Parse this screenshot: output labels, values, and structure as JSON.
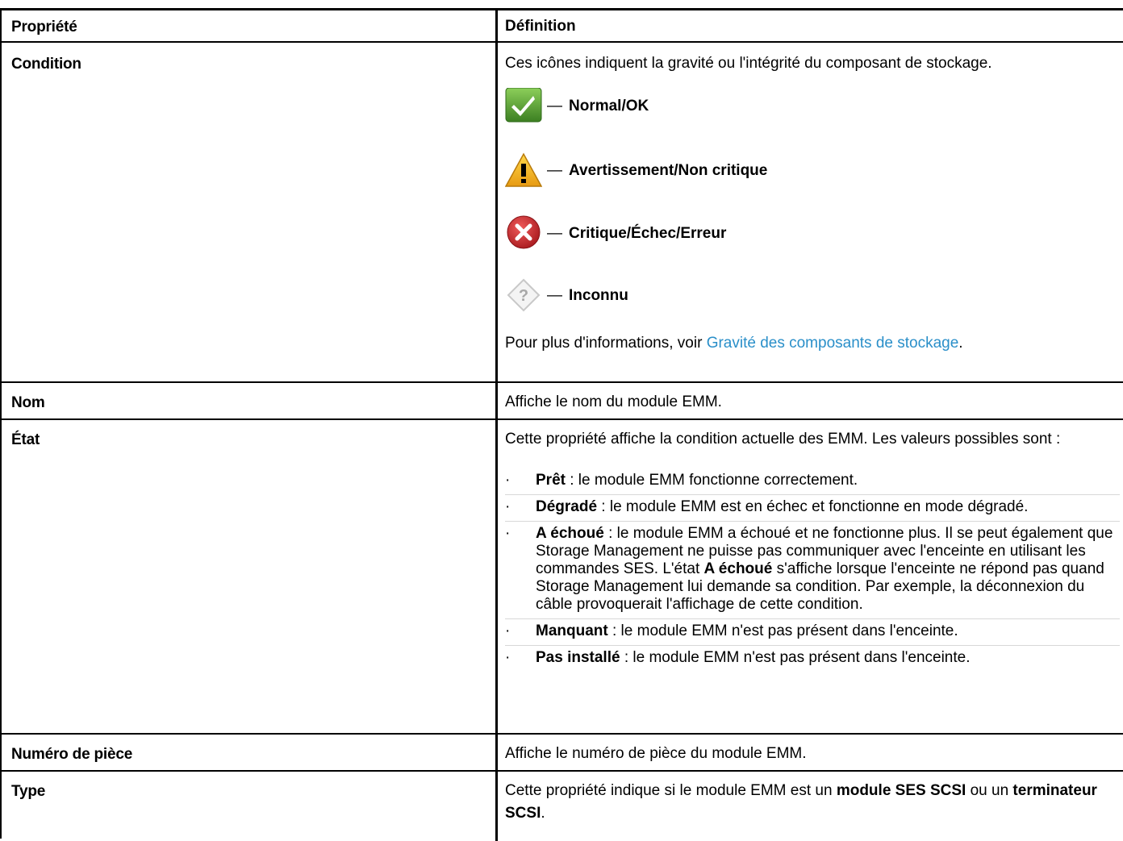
{
  "header": {
    "col1": "Propriété",
    "col2": "Définition"
  },
  "rows": {
    "condition": {
      "label": "Condition",
      "intro": "Ces icônes indiquent la gravité ou l'intégrité du composant de stockage.",
      "statuses": [
        {
          "icon": "ok-check-icon",
          "dash": "—",
          "label": "Normal/OK"
        },
        {
          "icon": "warning-triangle-icon",
          "dash": "—",
          "label": "Avertissement/Non critique"
        },
        {
          "icon": "critical-x-icon",
          "dash": "—",
          "label": "Critique/Échec/Erreur"
        },
        {
          "icon": "unknown-question-icon",
          "dash": "—",
          "label": "Inconnu"
        }
      ],
      "more_prefix": "Pour plus d'informations, voir ",
      "more_link": "Gravité des composants de stockage",
      "more_suffix": "."
    },
    "nom": {
      "label": "Nom",
      "text": "Affiche le nom du module EMM."
    },
    "etat": {
      "label": "État",
      "intro": "Cette propriété affiche la condition actuelle des EMM. Les valeurs possibles sont :",
      "bullet": "·",
      "items": [
        {
          "term": "Prêt",
          "text": " : le module EMM fonctionne correctement."
        },
        {
          "term": "Dégradé",
          "text": " : le module EMM est en échec et fonctionne en mode dégradé."
        },
        {
          "term": "A échoué",
          "text": " : le module EMM a échoué et ne fonctionne plus. Il se peut également que Storage Management ne puisse pas communiquer avec l'enceinte en utilisant les commandes SES. L'état ",
          "term2": "A échoué",
          "text2": " s'affiche lorsque l'enceinte ne répond pas quand Storage Management lui demande sa condition. Par exemple, la déconnexion du câble provoquerait l'affichage de cette condition."
        },
        {
          "term": "Manquant",
          "text": " : le module EMM n'est pas présent dans l'enceinte."
        },
        {
          "term": "Pas installé",
          "text": " : le module EMM n'est pas présent dans l'enceinte."
        }
      ]
    },
    "piece": {
      "label": "Numéro de pièce",
      "text": "Affiche le numéro de pièce du module EMM."
    },
    "type": {
      "label": "Type",
      "p1": "Cette propriété indique si le module EMM est un ",
      "b1": "module SES SCSI",
      "p2": " ou un ",
      "b2": "terminateur SCSI",
      "p3": "."
    }
  },
  "colors": {
    "link": "#2a8fc9",
    "ok": "#4a9a2e",
    "warning": "#f2b01e",
    "critical": "#c9272d"
  }
}
